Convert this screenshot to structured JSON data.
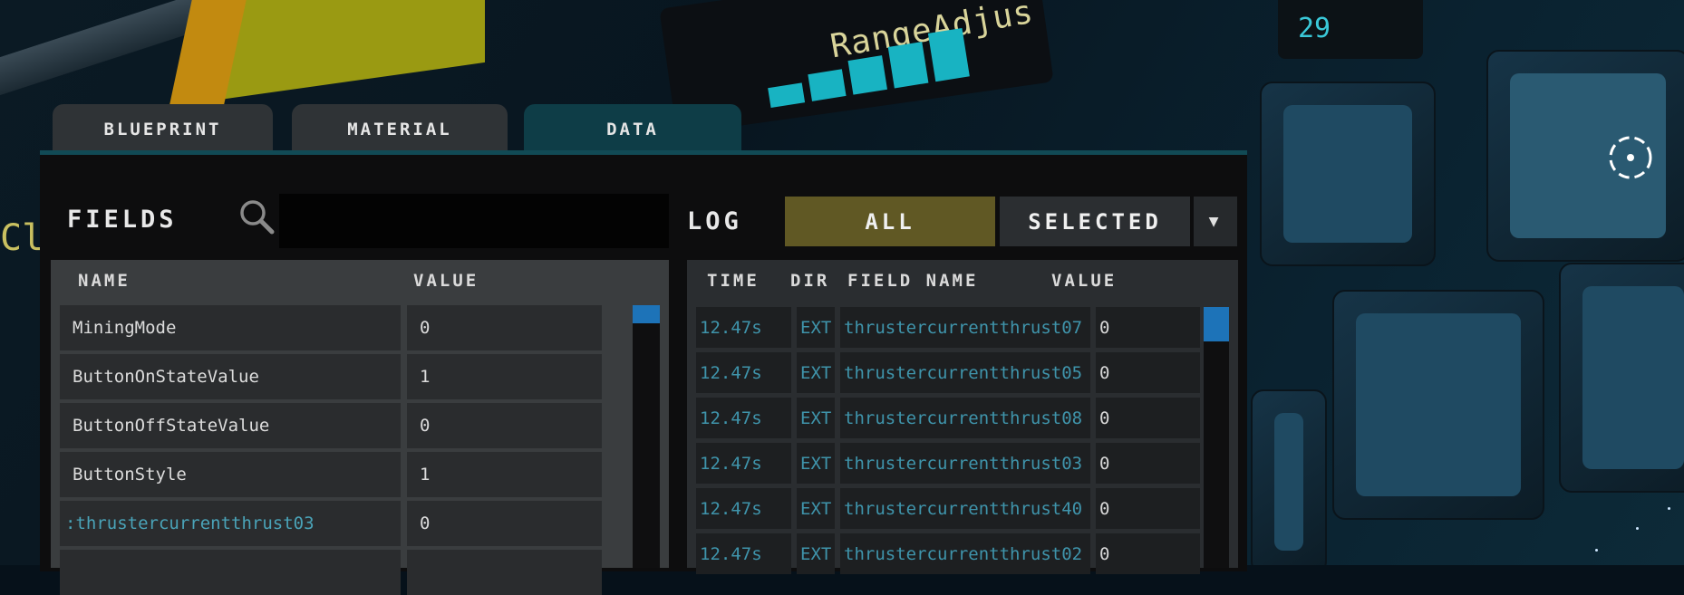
{
  "background": {
    "range_label": "RangeAdjus",
    "readout": "29",
    "partial_text": "Cl"
  },
  "tabs": [
    {
      "label": "BLUEPRINT",
      "active": false
    },
    {
      "label": "MATERIAL",
      "active": false
    },
    {
      "label": "DATA",
      "active": true
    }
  ],
  "fields": {
    "title": "FIELDS",
    "search_placeholder": "",
    "columns": {
      "name": "NAME",
      "value": "VALUE"
    },
    "rows": [
      {
        "name": "MiningMode",
        "value": "0"
      },
      {
        "name": "ButtonOnStateValue",
        "value": "1"
      },
      {
        "name": "ButtonOffStateValue",
        "value": "0"
      },
      {
        "name": "ButtonStyle",
        "value": "1"
      },
      {
        "name": ":thrustercurrentthrust03",
        "value": "0"
      }
    ]
  },
  "log": {
    "title": "LOG",
    "filter_all": "ALL",
    "filter_selected": "SELECTED",
    "dropdown_icon": "▼",
    "columns": {
      "time": "TIME",
      "dir": "DIR",
      "field_name": "FIELD NAME",
      "value": "VALUE"
    },
    "rows": [
      {
        "time": "12.47s",
        "dir": "EXT",
        "field_name": "thrustercurrentthrust07",
        "value": "0"
      },
      {
        "time": "12.47s",
        "dir": "EXT",
        "field_name": "thrustercurrentthrust05",
        "value": "0"
      },
      {
        "time": "12.47s",
        "dir": "EXT",
        "field_name": "thrustercurrentthrust08",
        "value": "0"
      },
      {
        "time": "12.47s",
        "dir": "EXT",
        "field_name": "thrustercurrentthrust03",
        "value": "0"
      },
      {
        "time": "12.47s",
        "dir": "EXT",
        "field_name": "thrustercurrentthrust40",
        "value": "0"
      },
      {
        "time": "12.47s",
        "dir": "EXT",
        "field_name": "thrustercurrentthrust02",
        "value": "0"
      }
    ]
  },
  "colors": {
    "active_tab": "#0e3d47",
    "filter_all_active": "#605824",
    "scroll_thumb": "#1d73b8",
    "log_text": "#3f94ab"
  }
}
